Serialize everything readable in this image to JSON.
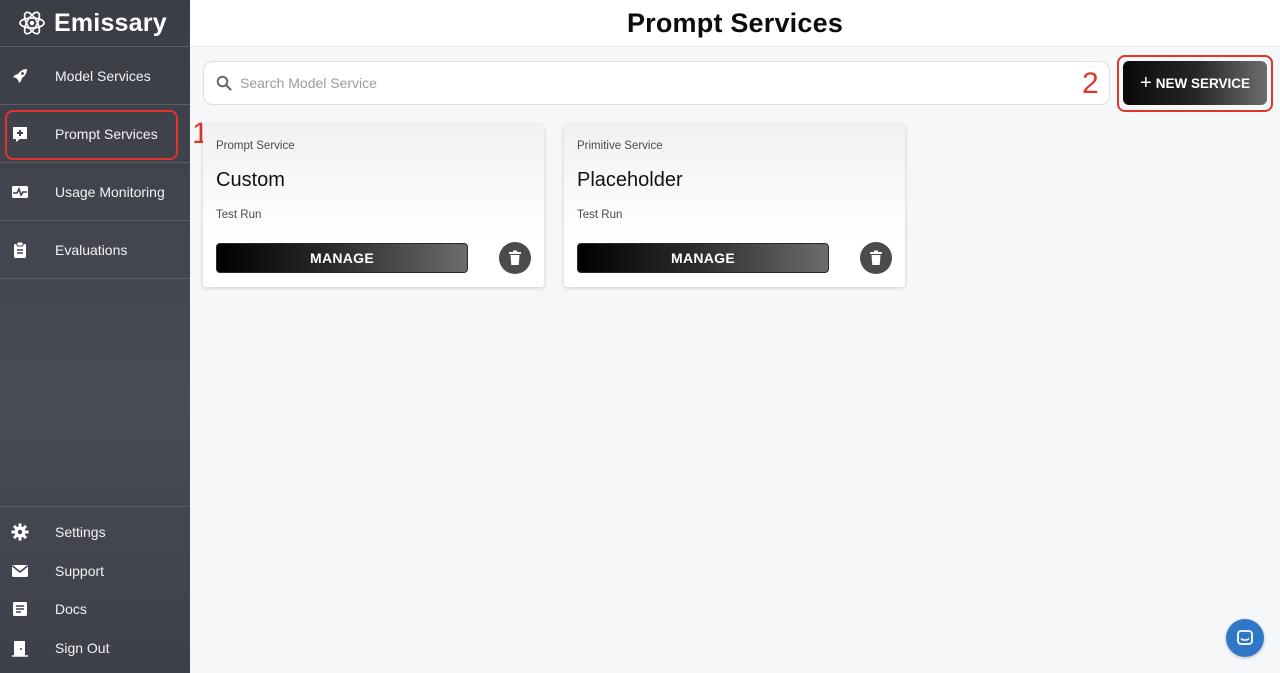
{
  "app": {
    "name": "Emissary",
    "logo_icon": "atom-icon"
  },
  "sidebar": {
    "items": [
      {
        "label": "Model Services",
        "icon": "rocket-icon"
      },
      {
        "label": "Prompt Services",
        "icon": "chat-plus-icon"
      },
      {
        "label": "Usage Monitoring",
        "icon": "pulse-icon"
      },
      {
        "label": "Evaluations",
        "icon": "clipboard-icon"
      }
    ],
    "bottom_items": [
      {
        "label": "Settings",
        "icon": "gear-icon"
      },
      {
        "label": "Support",
        "icon": "mail-icon"
      },
      {
        "label": "Docs",
        "icon": "document-icon"
      },
      {
        "label": "Sign Out",
        "icon": "door-exit-icon"
      }
    ]
  },
  "header": {
    "title": "Prompt Services"
  },
  "search": {
    "placeholder": "Search Model Service",
    "value": ""
  },
  "toolbar": {
    "new_service_plus": "+",
    "new_service_label": "NEW SERVICE"
  },
  "annotations": {
    "first": "1",
    "second": "2"
  },
  "cards": [
    {
      "type": "Prompt Service",
      "name": "Custom",
      "subtitle": "Test Run",
      "manage_label": "MANAGE"
    },
    {
      "type": "Primitive Service",
      "name": "Placeholder",
      "subtitle": "Test Run",
      "manage_label": "MANAGE"
    }
  ],
  "colors": {
    "accent_annotation": "#e0352b",
    "chat_bubble": "#2f78c8",
    "sidebar_bg": "#40424b"
  }
}
